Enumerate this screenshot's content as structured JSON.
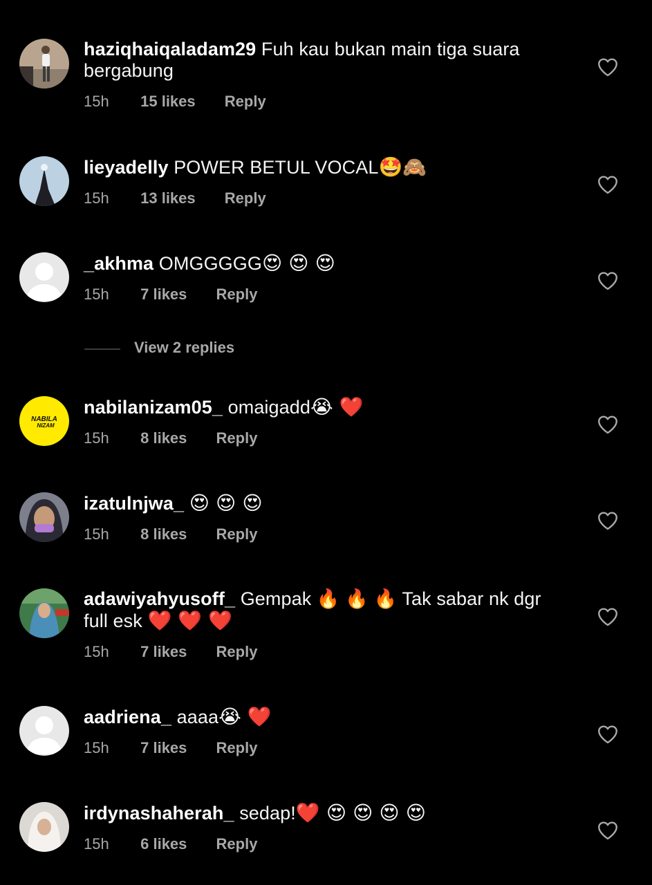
{
  "comments": [
    {
      "username": "haziqhaiqaladam29",
      "text": "Fuh kau bukan main tiga suara bergabung",
      "emojis": "",
      "time": "15h",
      "likes": "15 likes",
      "reply": "Reply",
      "avatar_icon": "person-photo-avatar"
    },
    {
      "username": "lieyadelly",
      "text": "POWER BETUL VOCAL",
      "emojis": "🤩🙈",
      "time": "15h",
      "likes": "13 likes",
      "reply": "Reply",
      "avatar_icon": "silhouette-photo-avatar"
    },
    {
      "username": "_akhma",
      "text": "OMGGGGG",
      "emojis": "😍 😍 😍",
      "time": "15h",
      "likes": "7 likes",
      "reply": "Reply",
      "avatar_icon": "default-avatar"
    },
    {
      "username": "nabilanizam05_",
      "text": "omaigadd",
      "emojis": "😭 ❤️",
      "time": "15h",
      "likes": "8 likes",
      "reply": "Reply",
      "avatar_icon": "nabila-nizam-logo-avatar",
      "avatar_text_1": "NABILA",
      "avatar_text_2": "NIZAM"
    },
    {
      "username": "izatulnjwa_",
      "text": "",
      "emojis": "😍 😍 😍",
      "time": "15h",
      "likes": "8 likes",
      "reply": "Reply",
      "avatar_icon": "person-photo-avatar"
    },
    {
      "username": "adawiyahyusoff_",
      "text": "Gempak 🔥 🔥 🔥 Tak sabar nk dgr full esk",
      "emojis": "❤️ ❤️ ❤️",
      "time": "15h",
      "likes": "7 likes",
      "reply": "Reply",
      "avatar_icon": "person-photo-avatar"
    },
    {
      "username": "aadriena_",
      "text": "aaaa",
      "emojis": "😭 ❤️",
      "time": "15h",
      "likes": "7 likes",
      "reply": "Reply",
      "avatar_icon": "default-avatar"
    },
    {
      "username": "irdynashaherah_",
      "text": "sedap!",
      "emojis": "❤️ 😍 😍 😍 😍",
      "time": "15h",
      "likes": "6 likes",
      "reply": "Reply",
      "avatar_icon": "person-photo-avatar"
    }
  ],
  "view_replies": "View 2 replies",
  "colors": {
    "background": "#000000",
    "primary_text": "#ffffff",
    "secondary_text": "#a8a8a8",
    "default_avatar": "#e8e8e8",
    "nabila_yellow": "#ffea00"
  }
}
